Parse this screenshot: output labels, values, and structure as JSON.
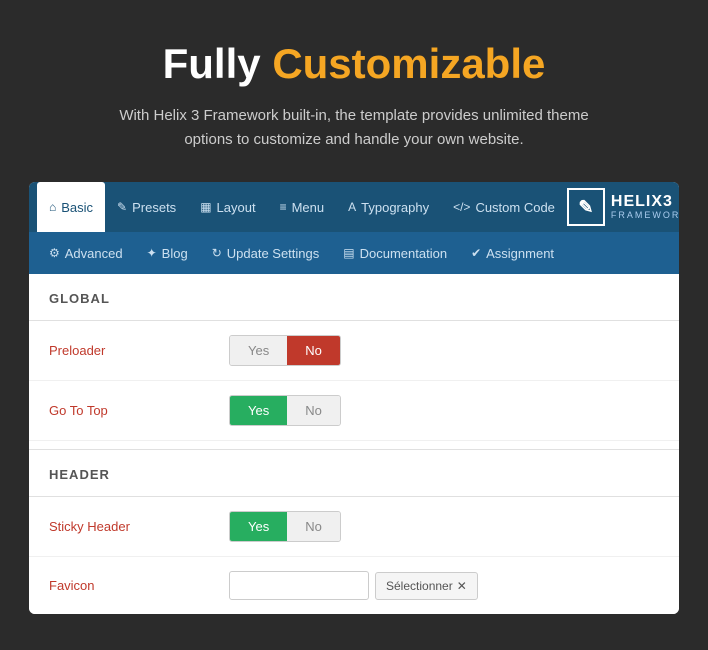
{
  "hero": {
    "title_white": "Fully",
    "title_orange": "Customizable",
    "subtitle": "With Helix 3 Framework built-in, the template provides unlimited theme options to customize and handle your own website."
  },
  "tabs_top": [
    {
      "id": "basic",
      "label": "Basic",
      "icon": "⌂",
      "active": true
    },
    {
      "id": "presets",
      "label": "Presets",
      "icon": "✎"
    },
    {
      "id": "layout",
      "label": "Layout",
      "icon": "▦"
    },
    {
      "id": "menu",
      "label": "Menu",
      "icon": "≡"
    },
    {
      "id": "typography",
      "label": "Typography",
      "icon": "A"
    },
    {
      "id": "custom-code",
      "label": "Custom Code",
      "icon": "<>"
    }
  ],
  "tabs_bottom": [
    {
      "id": "advanced",
      "label": "Advanced",
      "icon": "⚙"
    },
    {
      "id": "blog",
      "label": "Blog",
      "icon": "✦"
    },
    {
      "id": "update-settings",
      "label": "Update Settings",
      "icon": "↻"
    },
    {
      "id": "documentation",
      "label": "Documentation",
      "icon": "▤"
    },
    {
      "id": "assignment",
      "label": "Assignment",
      "icon": "✔"
    }
  ],
  "helix": {
    "logo_char": "✎",
    "name": "HELIX3",
    "sub": "FRAMEWORK"
  },
  "global_section": {
    "title": "GLOBAL",
    "fields": [
      {
        "id": "preloader",
        "label": "Preloader",
        "yes_active": false,
        "no_active": true
      },
      {
        "id": "go-to-top",
        "label": "Go To Top",
        "yes_active": true,
        "no_active": false
      }
    ]
  },
  "header_section": {
    "title": "HEADER",
    "fields": [
      {
        "id": "sticky-header",
        "label": "Sticky Header",
        "yes_active": true,
        "no_active": false
      }
    ]
  },
  "favicon": {
    "label": "Favicon",
    "placeholder": "",
    "btn_label": "Sélectionner"
  }
}
